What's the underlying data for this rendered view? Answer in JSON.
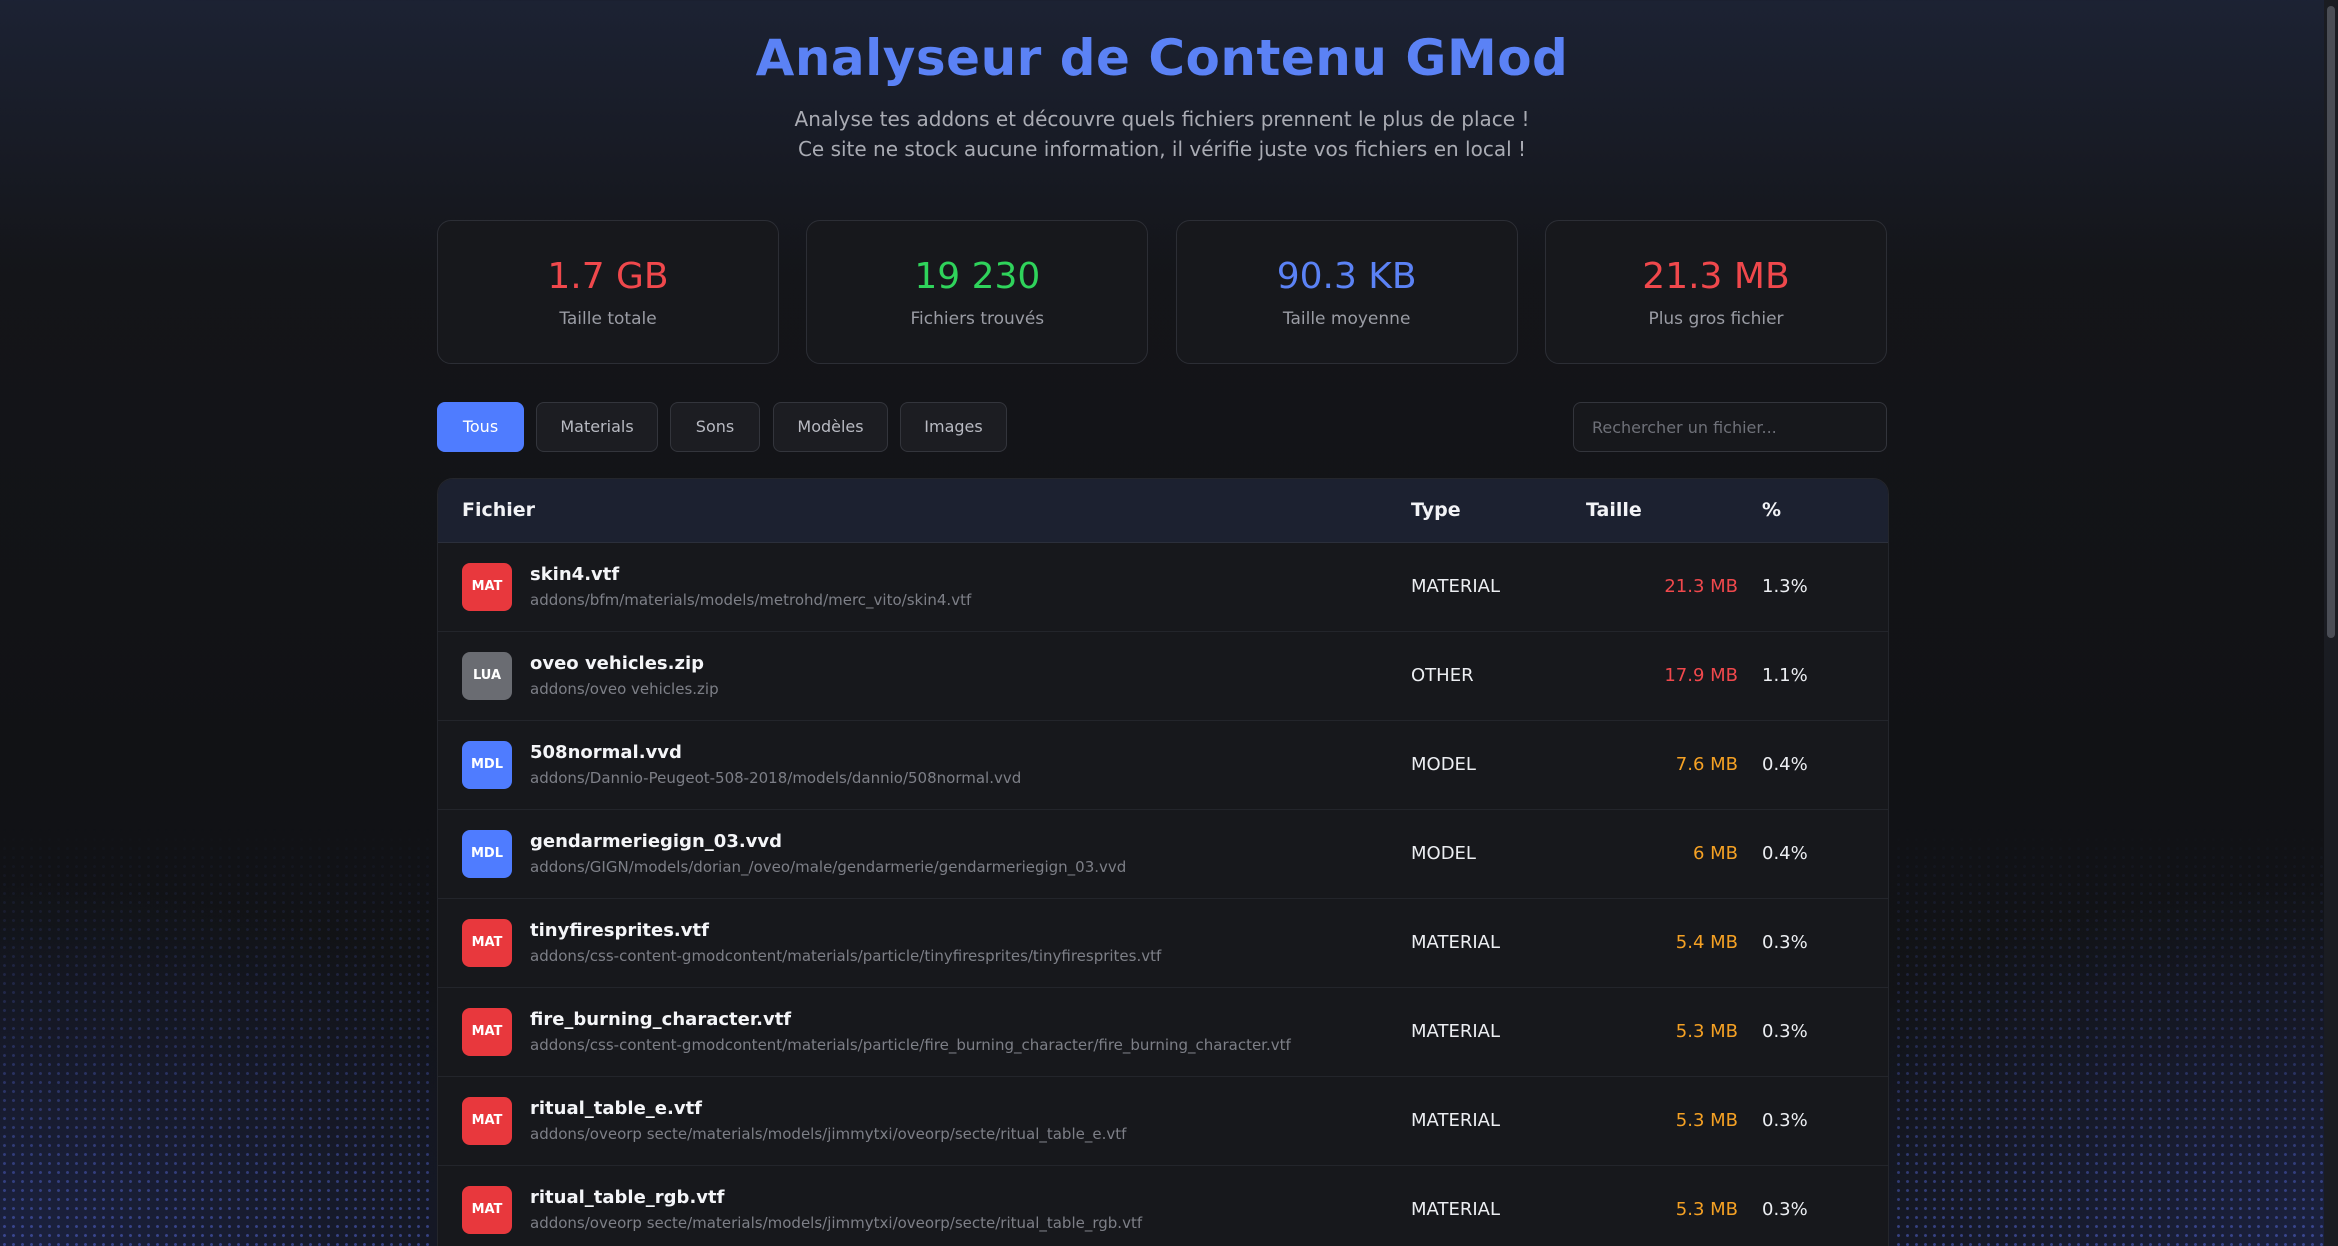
{
  "header": {
    "title": "Analyseur de Contenu GMod",
    "subtitle_line1": "Analyse tes addons et découvre quels fichiers prennent le plus de place !",
    "subtitle_line2": "Ce site ne stock aucune information, il vérifie juste vos fichiers en local !"
  },
  "stats": [
    {
      "value": "1.7 GB",
      "label": "Taille totale",
      "color": "#f0484c"
    },
    {
      "value": "19 230",
      "label": "Fichiers trouvés",
      "color": "#2fd35b"
    },
    {
      "value": "90.3 KB",
      "label": "Taille moyenne",
      "color": "#5b82f5"
    },
    {
      "value": "21.3 MB",
      "label": "Plus gros fichier",
      "color": "#f0484c"
    }
  ],
  "filters": [
    {
      "label": "Tous",
      "active": true
    },
    {
      "label": "Materials",
      "active": false
    },
    {
      "label": "Sons",
      "active": false
    },
    {
      "label": "Modèles",
      "active": false
    },
    {
      "label": "Images",
      "active": false
    }
  ],
  "search": {
    "placeholder": "Rechercher un fichier..."
  },
  "table": {
    "columns": {
      "file": "Fichier",
      "type": "Type",
      "size": "Taille",
      "percent": "%"
    },
    "rows": [
      {
        "badge": "MAT",
        "name": "skin4.vtf",
        "path": "addons/bfm/materials/models/metrohd/merc_vito/skin4.vtf",
        "type": "MATERIAL",
        "size": "21.3 MB",
        "percent": "1.3%"
      },
      {
        "badge": "LUA",
        "name": "oveo vehicles.zip",
        "path": "addons/oveo vehicles.zip",
        "type": "OTHER",
        "size": "17.9 MB",
        "percent": "1.1%"
      },
      {
        "badge": "MDL",
        "name": "508normal.vvd",
        "path": "addons/Dannio-Peugeot-508-2018/models/dannio/508normal.vvd",
        "type": "MODEL",
        "size": "7.6 MB",
        "percent": "0.4%"
      },
      {
        "badge": "MDL",
        "name": "gendarmeriegign_03.vvd",
        "path": "addons/GIGN/models/dorian_/oveo/male/gendarmerie/gendarmeriegign_03.vvd",
        "type": "MODEL",
        "size": "6 MB",
        "percent": "0.4%"
      },
      {
        "badge": "MAT",
        "name": "tinyfiresprites.vtf",
        "path": "addons/css-content-gmodcontent/materials/particle/tinyfiresprites/tinyfiresprites.vtf",
        "type": "MATERIAL",
        "size": "5.4 MB",
        "percent": "0.3%"
      },
      {
        "badge": "MAT",
        "name": "fire_burning_character.vtf",
        "path": "addons/css-content-gmodcontent/materials/particle/fire_burning_character/fire_burning_character.vtf",
        "type": "MATERIAL",
        "size": "5.3 MB",
        "percent": "0.3%"
      },
      {
        "badge": "MAT",
        "name": "ritual_table_e.vtf",
        "path": "addons/oveorp secte/materials/models/jimmytxi/oveorp/secte/ritual_table_e.vtf",
        "type": "MATERIAL",
        "size": "5.3 MB",
        "percent": "0.3%"
      },
      {
        "badge": "MAT",
        "name": "ritual_table_rgb.vtf",
        "path": "addons/oveorp secte/materials/models/jimmytxi/oveorp/secte/ritual_table_rgb.vtf",
        "type": "MATERIAL",
        "size": "5.3 MB",
        "percent": "0.3%"
      }
    ]
  }
}
